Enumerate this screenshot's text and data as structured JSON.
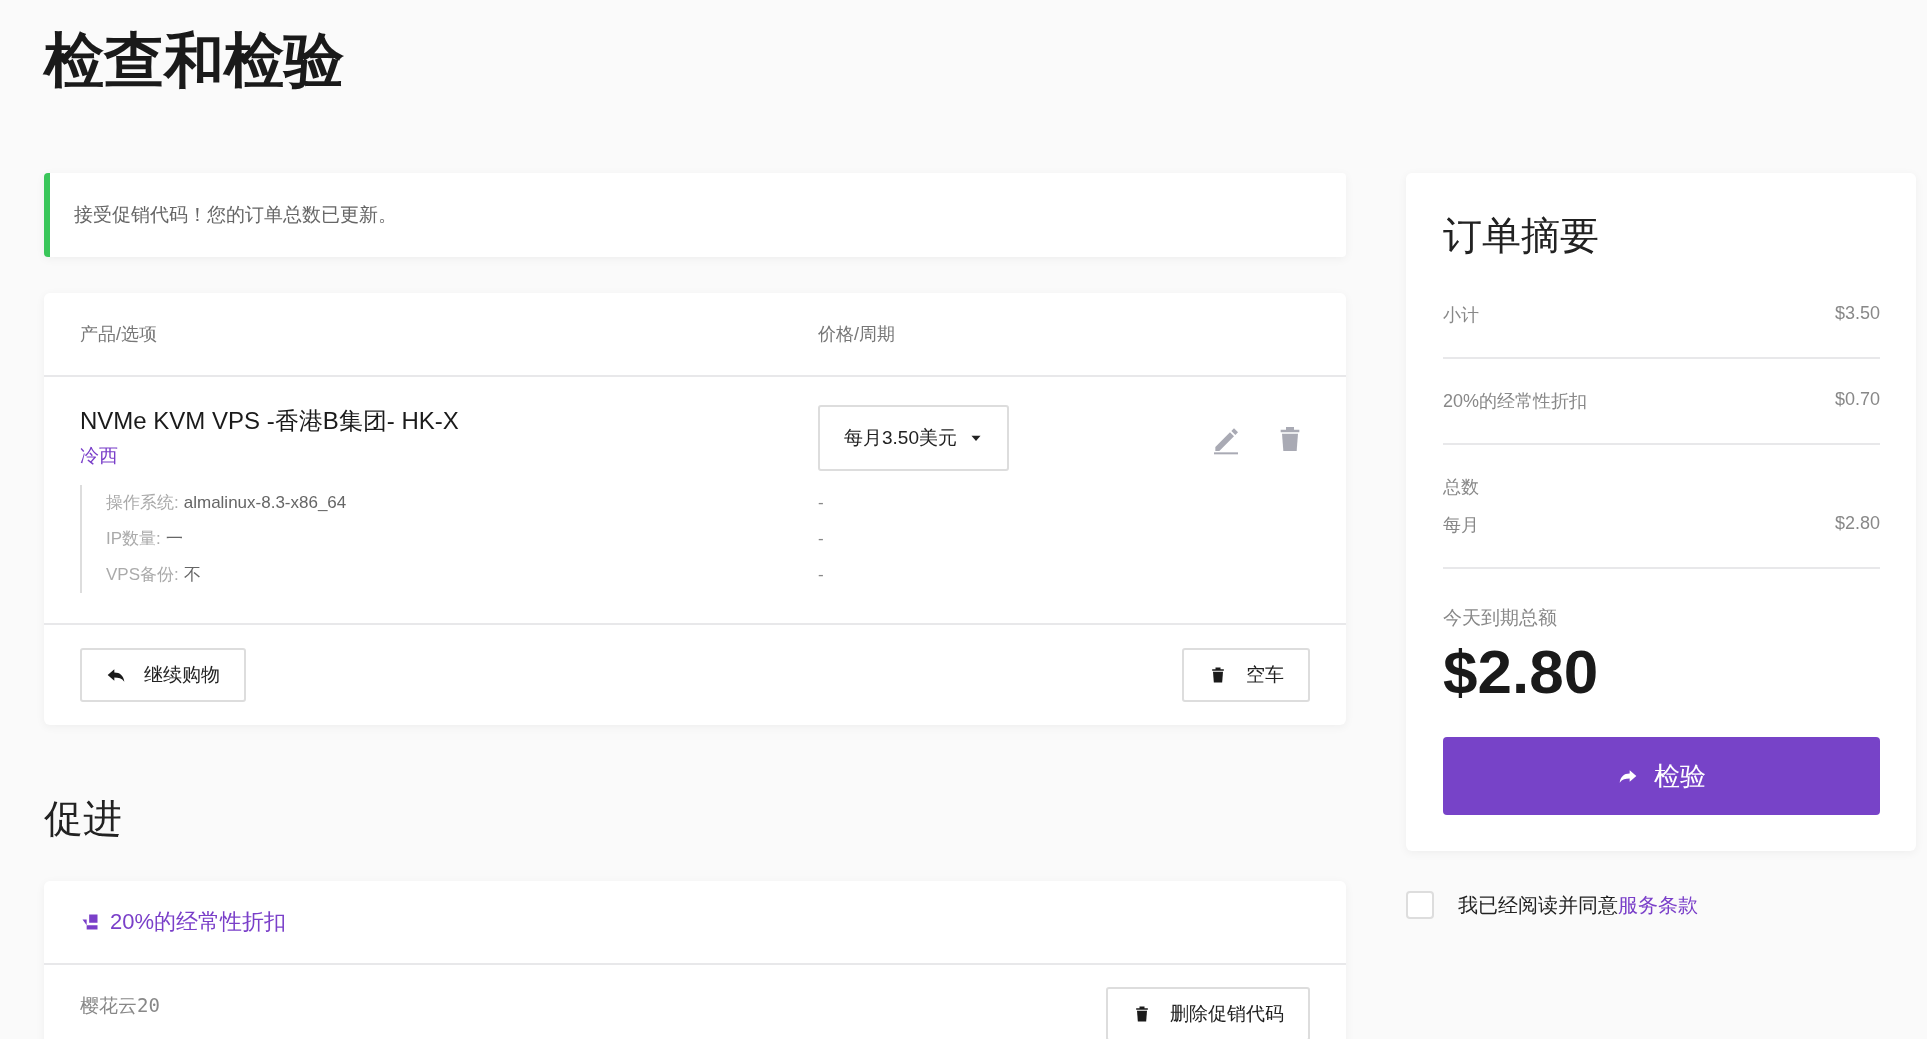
{
  "page_title": "检查和检验",
  "alert": {
    "text": "接受促销代码！您的订单总数已更新。"
  },
  "cart": {
    "columns": [
      "产品/选项",
      "价格/周期"
    ],
    "items": [
      {
        "name": "NVMe KVM VPS -香港B集团- HK-X",
        "group": "冷西",
        "billing_cycle": "每月3.50美元",
        "options": [
          {
            "name": "操作系统:",
            "setting": "almalinux-8.3-x86_64",
            "price": "-"
          },
          {
            "name": "IP数量:",
            "setting": "一",
            "price": "-"
          },
          {
            "name": "VPS备份:",
            "setting": "不",
            "price": "-"
          }
        ]
      }
    ],
    "continue_button": "继续购物",
    "empty_button": "空车"
  },
  "promotions": {
    "heading": "促进",
    "items": [
      {
        "title": "20%的经常性折扣",
        "code": "樱花云20",
        "remove_button": "删除促销代码"
      }
    ]
  },
  "summary": {
    "heading": "订单摘要",
    "lines": [
      {
        "label": "小计",
        "amount": "$3.50"
      },
      {
        "label": "20%的经常性折扣",
        "amount": "$0.70"
      }
    ],
    "total": {
      "label": "总数",
      "period": "每月",
      "amount": "$2.80"
    },
    "due_today_label": "今天到期总额",
    "due_today": "$2.80",
    "checkout_button": "检验"
  },
  "terms": {
    "checked": false,
    "text": "我已经阅读并同意",
    "link": "服务条款"
  }
}
